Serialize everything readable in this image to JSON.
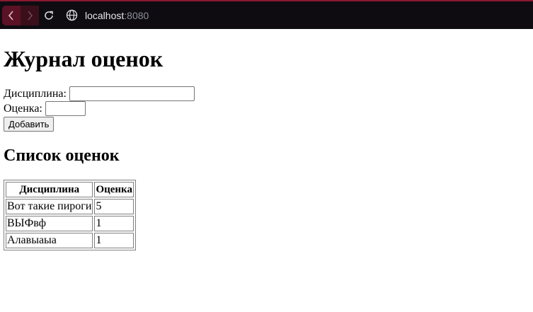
{
  "browser": {
    "url_host": "localhost",
    "url_port": ":8080",
    "icons": [
      "back-icon",
      "forward-icon",
      "reload-icon",
      "globe-icon"
    ]
  },
  "page": {
    "title": "Журнал оценок",
    "form": {
      "discipline_label": "Дисциплина:",
      "discipline_value": "",
      "grade_label": "Оценка:",
      "grade_value": "",
      "add_button": "Добавить"
    },
    "list_heading": "Список оценок",
    "table": {
      "headers": [
        "Дисциплина",
        "Оценка"
      ],
      "rows": [
        [
          "Вот такие пироги",
          "5"
        ],
        [
          "ВЫФвф",
          "1"
        ],
        [
          "Алавыаыа",
          "1"
        ]
      ]
    }
  }
}
